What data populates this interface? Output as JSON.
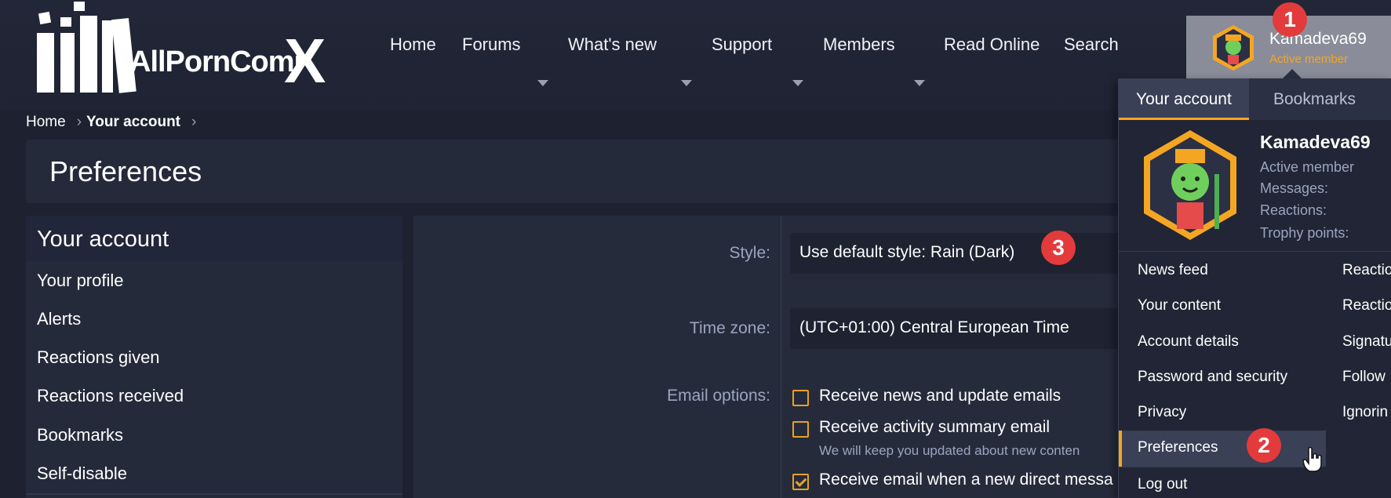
{
  "logo": {
    "text": "AllPornComi",
    "x_letter": "X"
  },
  "nav": {
    "items": [
      {
        "label": "Home"
      },
      {
        "label": "Forums"
      },
      {
        "label": "What's new"
      },
      {
        "label": "Support"
      },
      {
        "label": "Members"
      },
      {
        "label": "Read Online"
      },
      {
        "label": "Search"
      }
    ]
  },
  "user": {
    "name": "Kamadeva69",
    "status": "Active member"
  },
  "badges": [
    "1",
    "2",
    "3"
  ],
  "breadcrumb": {
    "items": [
      "Home",
      "Your account"
    ]
  },
  "page": {
    "title": "Preferences"
  },
  "sidebar": {
    "title": "Your account",
    "items": [
      "Your profile",
      "Alerts",
      "Reactions given",
      "Reactions received",
      "Bookmarks",
      "Self-disable"
    ]
  },
  "form": {
    "style_label": "Style:",
    "style_value": "Use default style: Rain (Dark)",
    "timezone_label": "Time zone:",
    "timezone_value": "(UTC+01:00) Central European Time",
    "email_label": "Email options:",
    "options": [
      {
        "label": "Receive news and update emails",
        "checked": false
      },
      {
        "label": "Receive activity summary email",
        "checked": false,
        "hint": "We will keep you updated about new conten"
      },
      {
        "label": "Receive email when a new direct messa",
        "checked": true
      }
    ]
  },
  "menu": {
    "tabs": [
      "Your account",
      "Bookmarks"
    ],
    "username": "Kamadeva69",
    "status": "Active member",
    "meta": [
      "Messages:",
      "Reactions:",
      "Trophy points:"
    ],
    "links_col1": [
      "News feed",
      "Your content",
      "Account details",
      "Password and security",
      "Privacy",
      "Preferences",
      "Log out"
    ],
    "links_col2": [
      "Reactio",
      "Reactio",
      "Signatu",
      "Follow",
      "Ignorin"
    ]
  },
  "colors": {
    "accent": "#f4a623",
    "badge": "#e33b3b",
    "background": "#1d2130"
  }
}
